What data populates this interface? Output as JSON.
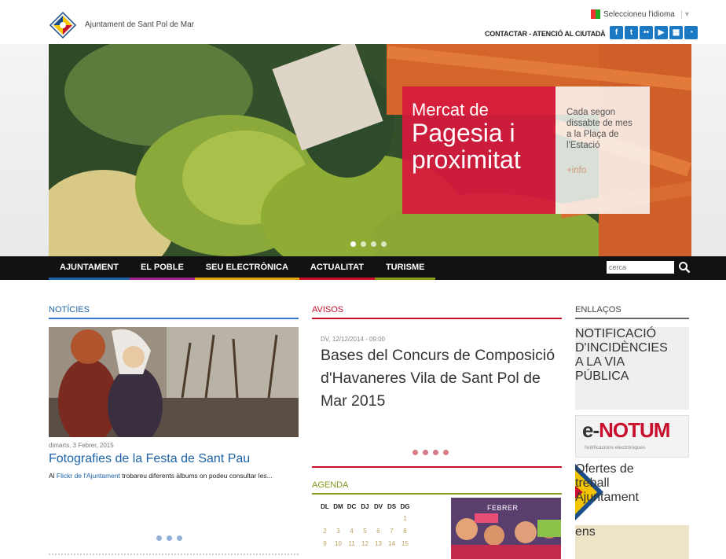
{
  "header": {
    "site_name": "Ajuntament de Sant Pol de Mar",
    "language_label": "Seleccioneu l'idioma",
    "contact_label": "CONTACTAR - ATENCIÓ AL CIUTADÀ",
    "social_icons": [
      "facebook-icon",
      "twitter-icon",
      "flickr-icon",
      "youtube-icon",
      "calendar-icon",
      "rss-icon"
    ]
  },
  "hero": {
    "title_line1": "Mercat de",
    "title_line2": "Pagesia i",
    "title_line3": "proximitat",
    "description": "Cada segon dissabte de mes a la Plaça de l'Estació",
    "more_label": "+info",
    "slide_count": 4,
    "active_slide": 1
  },
  "nav": {
    "items": [
      {
        "label": "AJUNTAMENT",
        "color": "#1b62a8"
      },
      {
        "label": "EL POBLE",
        "color": "#a0228c"
      },
      {
        "label": "SEU ELECTRÒNICA",
        "color": "#e3a516"
      },
      {
        "label": "ACTUALITAT",
        "color": "#c8102e"
      },
      {
        "label": "TURISME",
        "color": "#8a9a1e"
      }
    ],
    "search_placeholder": "cerca"
  },
  "noticies": {
    "title": "NOTÍCIES",
    "date": "dimarts, 3 Febrer, 2015",
    "headline": "Fotografies de la Festa de Sant Pau",
    "text_prefix": "Al ",
    "text_link": "Flickr de l'Ajuntament",
    "text_suffix": " trobareu diferents àlbums on podeu consultar les..."
  },
  "avisos": {
    "title": "AVISOS",
    "date": "DV, 12/12/2014 - 09:00",
    "headline": "Bases del Concurs de Composició d'Havaneres Vila de Sant Pol de Mar 2015"
  },
  "agenda": {
    "title": "AGENDA",
    "month": "FEBRER",
    "weekdays": [
      "DL",
      "DM",
      "DC",
      "DJ",
      "DV",
      "DS",
      "DG"
    ],
    "weeks": [
      [
        "",
        "",
        "",
        "",
        "",
        "",
        "1"
      ],
      [
        "2",
        "3",
        "4",
        "5",
        "6",
        "7",
        "8"
      ],
      [
        "9",
        "10",
        "11",
        "12",
        "13",
        "14",
        "15"
      ]
    ]
  },
  "enllacos": {
    "title": "ENLLAÇOS",
    "incidencies": "NOTIFICACIÓ D'INCIDÈNCIES A LA VIA PÚBLICA",
    "enotum_e": "e-",
    "enotum_n": "NOTUM",
    "enotum_sub": "Notificacions electròniques",
    "ofertes": "Ofertes de treball Ajuntament",
    "ens_label": "ens"
  },
  "colors": {
    "primary_blue": "#1b62a8",
    "red": "#c8102e",
    "green": "#8a9a1e",
    "nav_bg": "#111111"
  }
}
